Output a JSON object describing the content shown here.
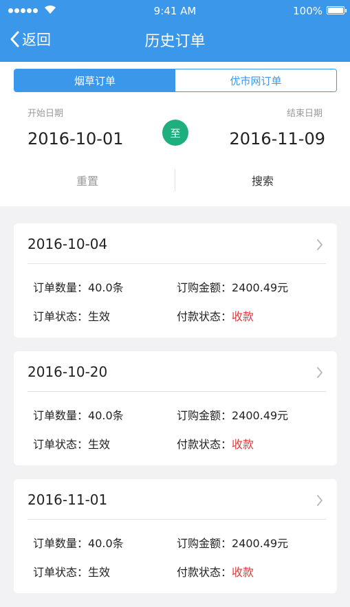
{
  "status_bar": {
    "time": "9:41 AM",
    "battery_percent": "100%",
    "battery_level": 1.0,
    "icons": [
      "signal-dots",
      "wifi-icon",
      "battery-icon"
    ]
  },
  "nav": {
    "back_label": "返回",
    "title": "历史订单",
    "back_icon": "chevron-left-icon"
  },
  "segment": {
    "tabs": [
      "烟草订单",
      "优市网订单"
    ],
    "active_index": 0
  },
  "date_range": {
    "start_label": "开始日期",
    "start_value": "2016-10-01",
    "to_label": "至",
    "end_label": "结束日期",
    "end_value": "2016-11-09"
  },
  "actions": {
    "reset_label": "重置",
    "search_label": "搜索"
  },
  "orders": [
    {
      "date": "2016-10-04",
      "qty_label": "订单数量：",
      "qty_value": "40.0条",
      "amount_label": "订购金额：",
      "amount_value": "2400.49元",
      "status_label": "订单状态：",
      "status_value": "生效",
      "pay_label": "付款状态：",
      "pay_value": "收款"
    },
    {
      "date": "2016-10-20",
      "qty_label": "订单数量：",
      "qty_value": "40.0条",
      "amount_label": "订购金额：",
      "amount_value": "2400.49元",
      "status_label": "订单状态：",
      "status_value": "生效",
      "pay_label": "付款状态：",
      "pay_value": "收款"
    },
    {
      "date": "2016-11-01",
      "qty_label": "订单数量：",
      "qty_value": "40.0条",
      "amount_label": "订购金额：",
      "amount_value": "2400.49元",
      "status_label": "订单状态：",
      "status_value": "生效",
      "pay_label": "付款状态：",
      "pay_value": "收款"
    }
  ],
  "colors": {
    "header": "#3b97ea",
    "accent_green": "#1fae7e",
    "pay_status": "#e23a3a",
    "page_bg": "#f2f2f4"
  }
}
